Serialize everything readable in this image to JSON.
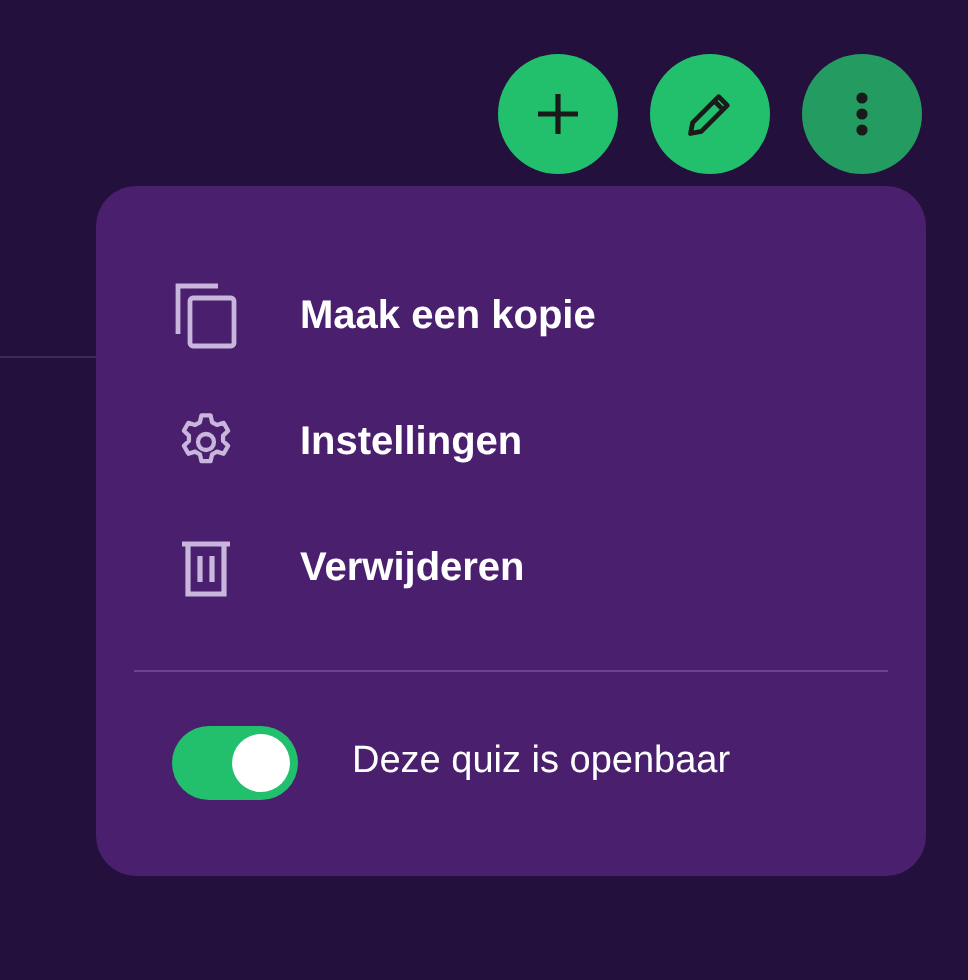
{
  "toolbar": [
    {
      "kind": "add",
      "active": false
    },
    {
      "kind": "edit",
      "active": false
    },
    {
      "kind": "more",
      "active": true
    }
  ],
  "menu": {
    "items": [
      {
        "kind": "copy",
        "label": "Maak een kopie"
      },
      {
        "kind": "settings",
        "label": "Instellingen"
      },
      {
        "kind": "delete",
        "label": "Verwijderen"
      }
    ],
    "toggle": {
      "label": "Deze quiz is openbaar",
      "on": true
    }
  }
}
